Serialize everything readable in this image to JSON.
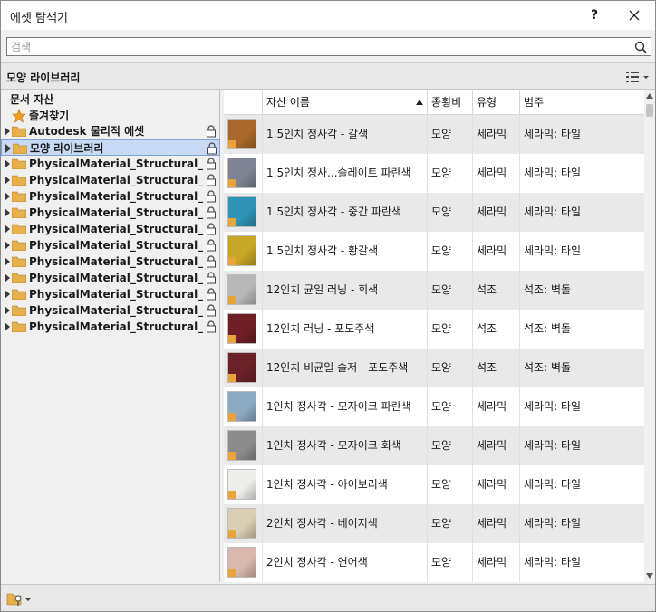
{
  "window": {
    "title": "에셋 탐색기",
    "help_label": "?"
  },
  "search": {
    "placeholder": "검색",
    "value": ""
  },
  "library_bar": {
    "title": "모양 라이브러리"
  },
  "tree": {
    "items": [
      {
        "label": "문서 자산",
        "type": "heading"
      },
      {
        "label": "즐겨찾기",
        "type": "favorites"
      },
      {
        "label": "Autodesk 물리적 에셋",
        "type": "locked-library"
      },
      {
        "label": "모양 라이브러리",
        "type": "locked-library",
        "selected": true
      },
      {
        "label": "PhysicalMaterial_Structural_Aus...",
        "type": "locked-library"
      },
      {
        "label": "PhysicalMaterial_Structural_Can...",
        "type": "locked-library"
      },
      {
        "label": "PhysicalMaterial_Structural_Ger...",
        "type": "locked-library"
      },
      {
        "label": "PhysicalMaterial_Structural_Italy",
        "type": "locked-library"
      },
      {
        "label": "PhysicalMaterial_Structural_Japan",
        "type": "locked-library"
      },
      {
        "label": "PhysicalMaterial_Structural_Net...",
        "type": "locked-library"
      },
      {
        "label": "PhysicalMaterial_Structural_Nor...",
        "type": "locked-library"
      },
      {
        "label": "PhysicalMaterial_Structural_Pol...",
        "type": "locked-library"
      },
      {
        "label": "PhysicalMaterial_Structural_Rus...",
        "type": "locked-library"
      },
      {
        "label": "PhysicalMaterial_Structural_UK",
        "type": "locked-library"
      },
      {
        "label": "PhysicalMaterial_Structural_US",
        "type": "locked-library"
      }
    ]
  },
  "grid": {
    "columns": [
      "자산 이름",
      "종횡비",
      "유형",
      "범주"
    ],
    "sort_column": "자산 이름",
    "sort_direction": "ascending",
    "rows": [
      {
        "name": "1.5인치 정사각 - 갈색",
        "aspect": "모양",
        "type": "세라믹",
        "category": "세라믹: 타일",
        "swatch": "#a8682a"
      },
      {
        "name": "1.5인치 정사...슬레이트 파란색",
        "aspect": "모양",
        "type": "세라믹",
        "category": "세라믹: 타일",
        "swatch": "#7f8494"
      },
      {
        "name": "1.5인치 정사각 - 중간 파란색",
        "aspect": "모양",
        "type": "세라믹",
        "category": "세라믹: 타일",
        "swatch": "#2f93b3"
      },
      {
        "name": "1.5인치 정사각 - 황갈색",
        "aspect": "모양",
        "type": "세라믹",
        "category": "세라믹: 타일",
        "swatch": "#c8a626"
      },
      {
        "name": "12인치 균일 러닝 - 회색",
        "aspect": "모양",
        "type": "석조",
        "category": "석조: 벽돌",
        "swatch": "#b8b8b8"
      },
      {
        "name": "12인치 러닝 - 포도주색",
        "aspect": "모양",
        "type": "석조",
        "category": "석조: 벽돌",
        "swatch": "#6e1f25"
      },
      {
        "name": "12인치 비균일 솔저 - 포도주색",
        "aspect": "모양",
        "type": "석조",
        "category": "석조: 벽돌",
        "swatch": "#6a2228"
      },
      {
        "name": "1인치 정사각 - 모자이크 파란색",
        "aspect": "모양",
        "type": "세라믹",
        "category": "세라믹: 타일",
        "swatch": "#8ca9c2"
      },
      {
        "name": "1인치 정사각 - 모자이크 회색",
        "aspect": "모양",
        "type": "세라믹",
        "category": "세라믹: 타일",
        "swatch": "#8c8c8c"
      },
      {
        "name": "1인치 정사각 - 아이보리색",
        "aspect": "모양",
        "type": "세라믹",
        "category": "세라믹: 타일",
        "swatch": "#ededeb"
      },
      {
        "name": "2인치 정사각 - 베이지색",
        "aspect": "모양",
        "type": "세라믹",
        "category": "세라믹: 타일",
        "swatch": "#d9cdb3"
      },
      {
        "name": "2인치 정사각 - 연어색",
        "aspect": "모양",
        "type": "세라믹",
        "category": "세라믹: 타일",
        "swatch": "#d8b8ad"
      }
    ]
  },
  "icons": {
    "search": "search-icon",
    "close": "close-icon",
    "view_options": "list-view-icon",
    "folder": "folder-icon",
    "lock": "lock-icon",
    "favorites": "star-icon",
    "manage_library": "library-manage-icon"
  },
  "colors": {
    "selection": "#c7d9f3",
    "star": "#f0a020",
    "folder": "#e8b04a"
  }
}
